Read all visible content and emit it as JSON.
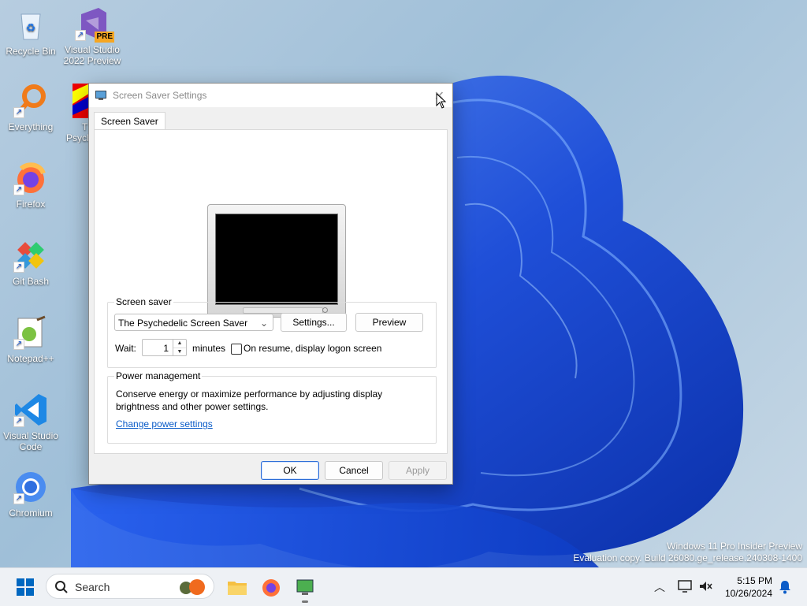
{
  "desktop": {
    "icons": [
      {
        "label": "Recycle Bin",
        "icon": "recycle-bin-icon"
      },
      {
        "label": "Visual Studio 2022 Preview",
        "line1": "Visual Studio",
        "line2": "2022 Preview",
        "badge": "PRE",
        "icon": "visual-studio-icon"
      },
      {
        "label": "Everything",
        "icon": "everything-search-icon"
      },
      {
        "label_fragment": "T",
        "label_fragment2": "Psych",
        "icon": "psychedelic-icon"
      },
      {
        "label": "Firefox",
        "icon": "firefox-icon"
      },
      {
        "label": "Git Bash",
        "icon": "git-bash-icon"
      },
      {
        "label": "Notepad++",
        "icon": "notepad-plus-plus-icon"
      },
      {
        "label": "Visual Studio Code",
        "line1": "Visual Studio",
        "line2": "Code",
        "icon": "vscode-icon"
      },
      {
        "label": "Chromium",
        "icon": "chromium-icon"
      }
    ],
    "watermark": {
      "line1": "Windows 11 Pro Insider Preview",
      "line2": "Evaluation copy. Build 26080.ge_release.240308-1400"
    }
  },
  "dialog": {
    "title": "Screen Saver Settings",
    "close_glyph": "✕",
    "tab": "Screen Saver",
    "screen_saver_group": {
      "label": "Screen saver",
      "selected": "The Psychedelic Screen Saver",
      "settings_button": "Settings...",
      "preview_button": "Preview",
      "wait_label": "Wait:",
      "wait_value": "1",
      "minutes_label": "minutes",
      "resume_checkbox_label": "On resume, display logon screen",
      "resume_checked": false
    },
    "power_group": {
      "label": "Power management",
      "text_line1": "Conserve energy or maximize performance by adjusting display",
      "text_line2": "brightness and other power settings.",
      "link": "Change power settings"
    },
    "buttons": {
      "ok": "OK",
      "cancel": "Cancel",
      "apply": "Apply"
    }
  },
  "taskbar": {
    "search_placeholder": "Search",
    "time": "5:15 PM",
    "date": "10/26/2024",
    "accent": "#0067c0"
  }
}
